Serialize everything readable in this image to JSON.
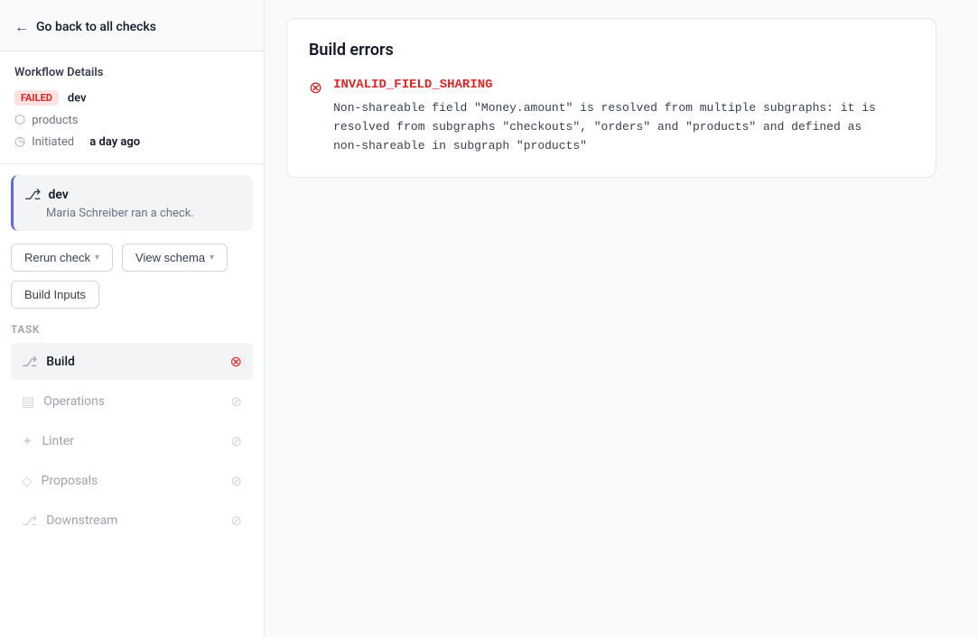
{
  "back": {
    "label": "Go back to all checks"
  },
  "workflow": {
    "title": "Workflow Details",
    "status": "FAILED",
    "env": "dev",
    "product": "products",
    "initiated_label": "Initiated",
    "initiated_value": "a day ago"
  },
  "check_card": {
    "icon": "⎇",
    "name": "dev",
    "description": "Maria Schreiber ran a check."
  },
  "buttons": {
    "rerun": "Rerun check",
    "schema": "View schema",
    "inputs": "Build Inputs"
  },
  "task": {
    "title": "Task",
    "items": [
      {
        "id": "build",
        "label": "Build",
        "icon": "⎇",
        "status": "error",
        "active": true
      },
      {
        "id": "operations",
        "label": "Operations",
        "icon": "☰",
        "status": "skip",
        "active": false
      },
      {
        "id": "linter",
        "label": "Linter",
        "icon": "✦",
        "status": "skip",
        "active": false
      },
      {
        "id": "proposals",
        "label": "Proposals",
        "icon": "◇",
        "status": "skip",
        "active": false
      },
      {
        "id": "downstream",
        "label": "Downstream",
        "icon": "⎇",
        "status": "skip",
        "active": false
      }
    ]
  },
  "errors": {
    "title": "Build errors",
    "items": [
      {
        "code": "INVALID_FIELD_SHARING",
        "message": "Non-shareable field \"Money.amount\" is resolved from multiple subgraphs: it is\nresolved from subgraphs \"checkouts\", \"orders\" and \"products\" and defined as\nnon-shareable in subgraph \"products\""
      }
    ]
  }
}
